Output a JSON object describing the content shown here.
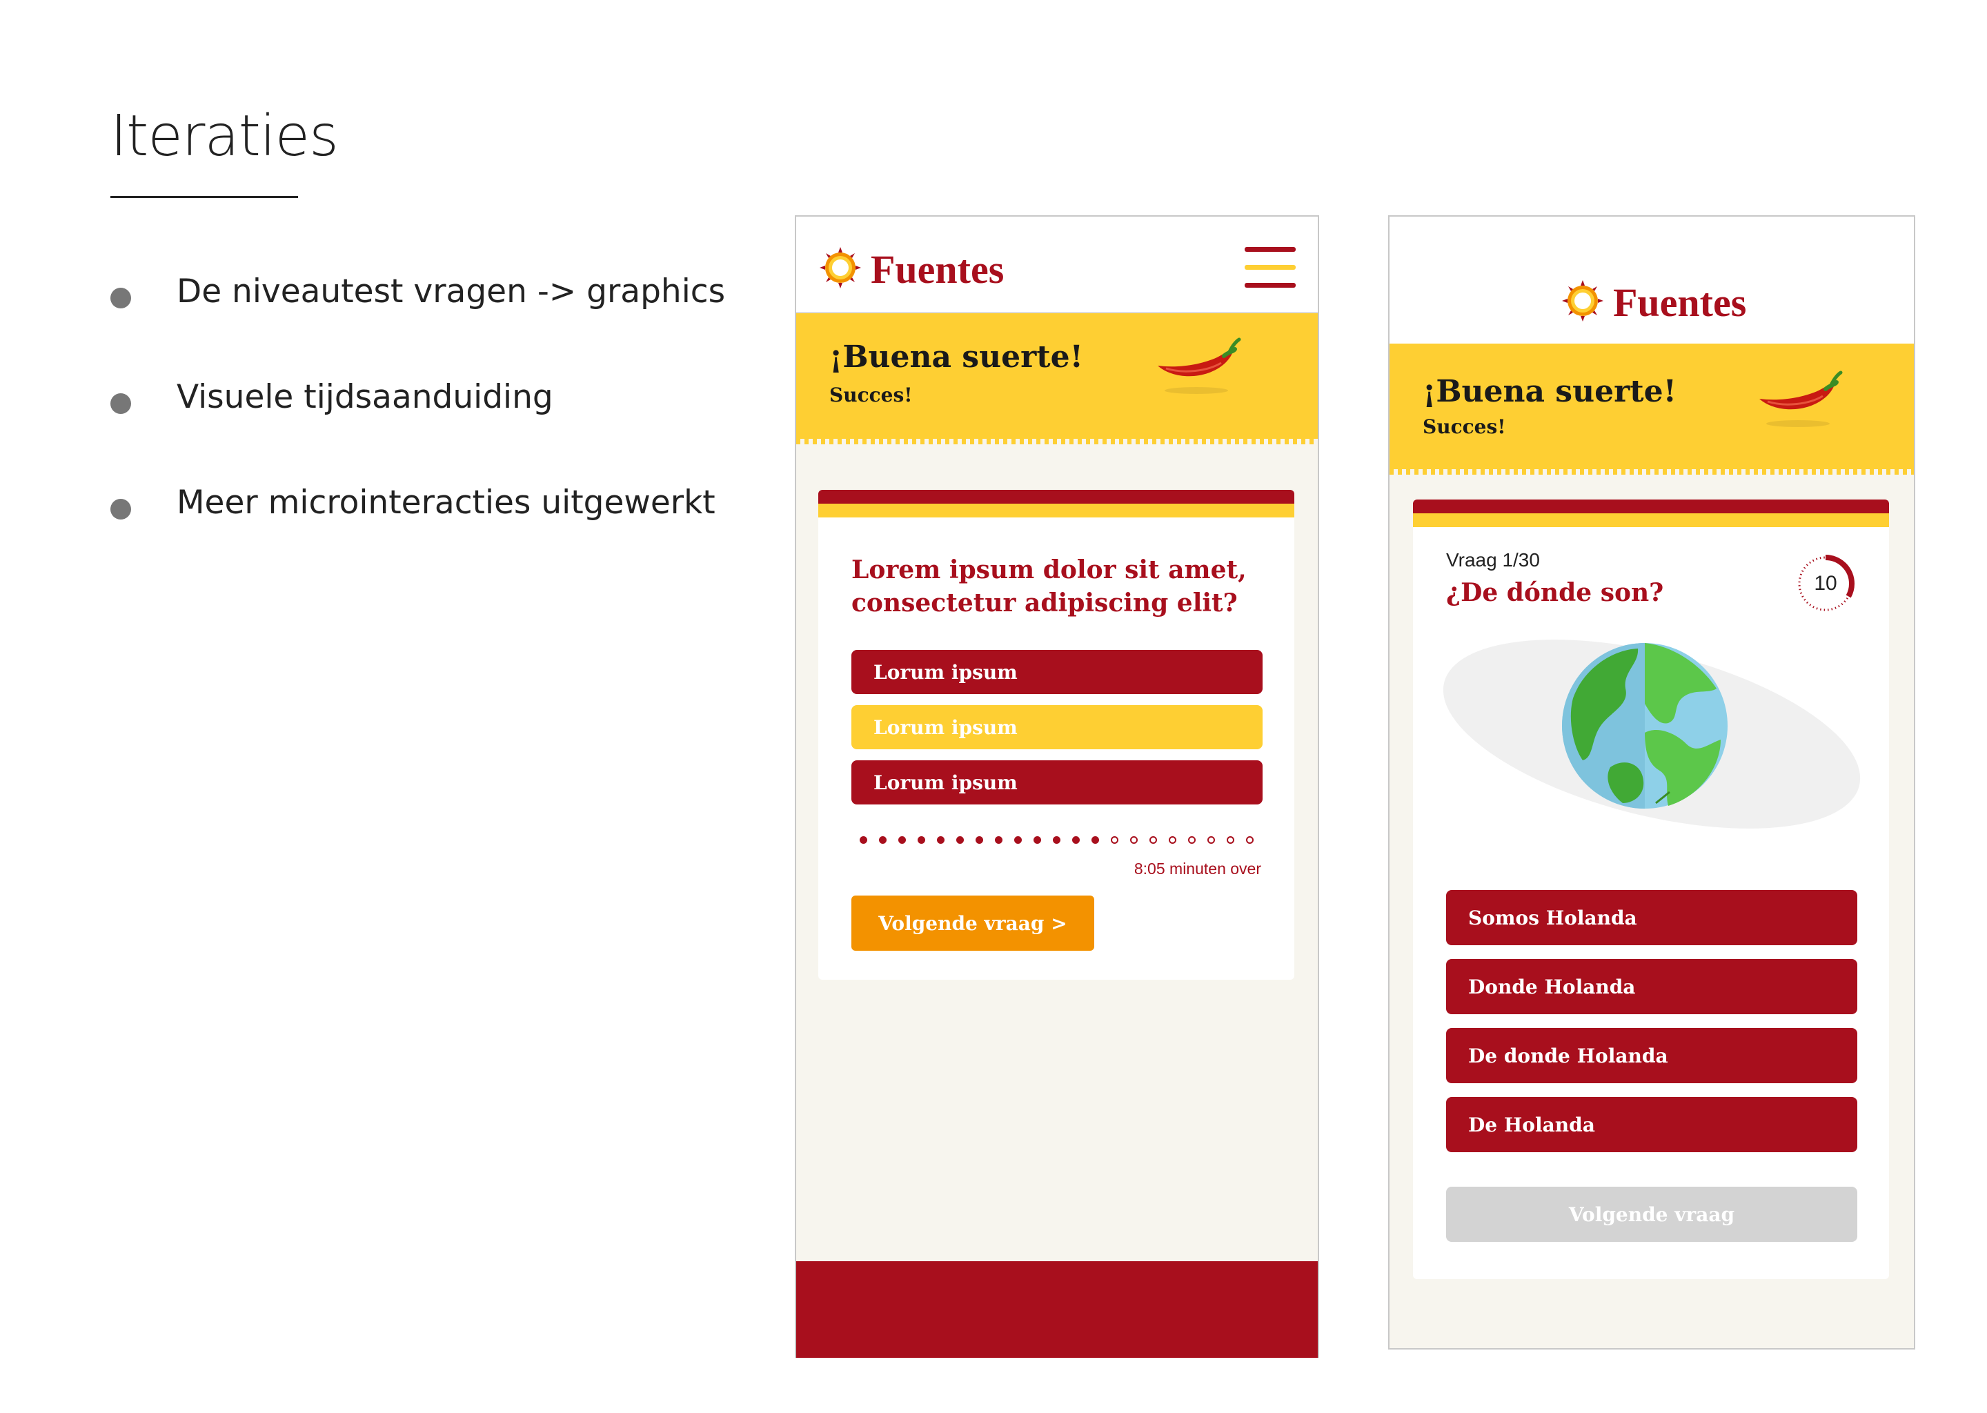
{
  "slide": {
    "title": "Iteraties",
    "bullets": [
      "De niveautest vragen -> graphics",
      "Visuele tijdsaanduiding",
      "Meer microinteracties uitgewerkt"
    ]
  },
  "colors": {
    "brand_red": "#a80f1d",
    "brand_yellow": "#fecf33",
    "cta_orange": "#f39200",
    "disabled_grey": "#d3d3d3",
    "phone_background": "#f7f5ee"
  },
  "phone_old": {
    "brand": "Fuentes",
    "menu_icon": "hamburger-menu-icon",
    "banner": {
      "title": "¡Buena suerte!",
      "subtitle": "Succes!",
      "icon": "chili-pepper-icon"
    },
    "question": "Lorem ipsum dolor sit amet, consectetur adipiscing elit?",
    "answers": [
      "Lorum ipsum",
      "Lorum ipsum",
      "Lorum ipsum"
    ],
    "selected_answer_index": 1,
    "progress": {
      "answered": 13,
      "total": 21
    },
    "time_remaining": "8:05 minuten over",
    "next_button": "Volgende vraag >"
  },
  "phone_new": {
    "brand": "Fuentes",
    "banner": {
      "title": "¡Buena suerte!",
      "subtitle": "Succes!",
      "icon": "chili-pepper-icon"
    },
    "question_counter": "Vraag 1/30",
    "question": "¿De dónde son?",
    "timer": {
      "seconds_left": "10",
      "fraction_remaining": 0.33
    },
    "illustration": "globe-icon",
    "answers": [
      "Somos Holanda",
      "Donde Holanda",
      "De donde Holanda",
      "De Holanda"
    ],
    "next_button": "Volgende vraag",
    "next_button_state": "disabled"
  }
}
